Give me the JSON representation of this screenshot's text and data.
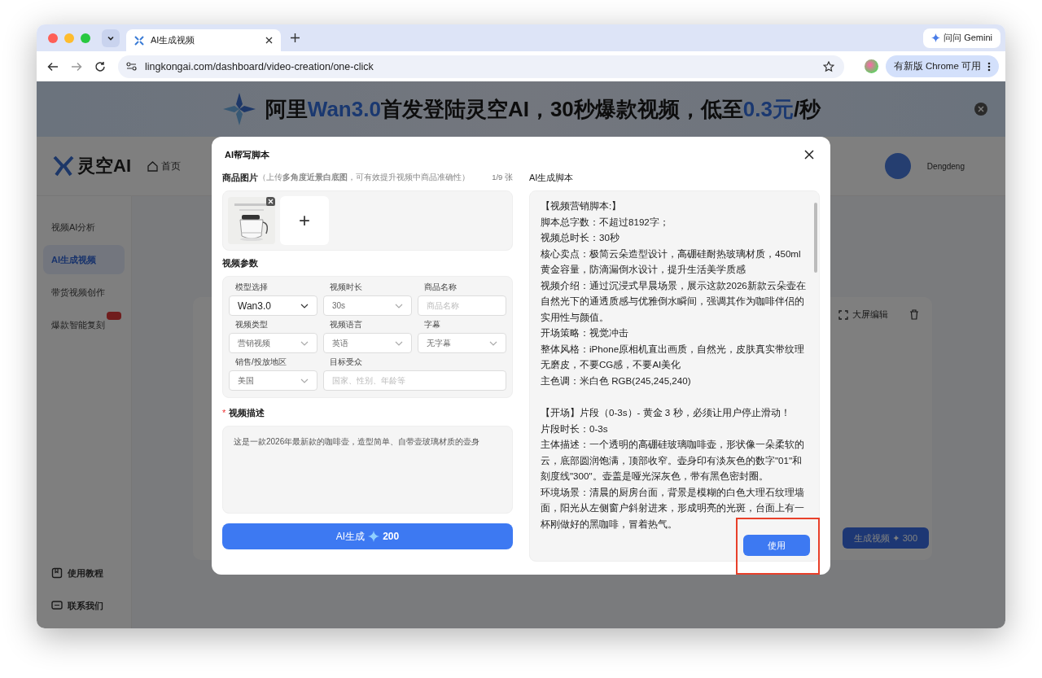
{
  "browser": {
    "tab_title": "AI生成视频",
    "url": "lingkongai.com/dashboard/video-creation/one-click",
    "gemini_button": "问问 Gemini",
    "update_button": "有新版 Chrome 可用"
  },
  "app": {
    "banner": {
      "segments": [
        {
          "text": "阿里",
          "highlight": false
        },
        {
          "text": "Wan3.0",
          "highlight": true
        },
        {
          "text": "首发登陆灵空AI，30秒爆款视频，低至",
          "highlight": false
        },
        {
          "text": "0.3元",
          "highlight": true
        },
        {
          "text": "/秒",
          "highlight": false
        }
      ]
    },
    "logo": "灵空AI",
    "nav_home": "首页",
    "user": {
      "name": "Dengdeng"
    },
    "sidebar": {
      "items": [
        {
          "label": "视频AI分析",
          "selected": false,
          "hot": false
        },
        {
          "label": "AI生成视频",
          "selected": true,
          "hot": false
        },
        {
          "label": "带货视频创作",
          "selected": false,
          "hot": false
        },
        {
          "label": "爆款智能复刻",
          "selected": false,
          "hot": true
        }
      ],
      "footer": [
        "使用教程",
        "联系我们"
      ]
    },
    "main": {
      "fullscreen_button": "大屏编辑",
      "generate_button": "生成视频",
      "generate_icon": "✦",
      "generate_cost": "300"
    }
  },
  "modal": {
    "title": "AI帮写脚本",
    "product_images": {
      "label": "商品图片",
      "hint": "（上传**多角度近景白底图**，可有效提升视频中商品准确性）",
      "count": "1/9 张",
      "add_label": "+"
    },
    "params": {
      "title": "视频参数",
      "fields": [
        {
          "label": "模型选择",
          "kind": "select",
          "value": "Wan3.0",
          "disabled": false,
          "wide": false
        },
        {
          "label": "视频时长",
          "kind": "select",
          "value": "30s",
          "disabled": true,
          "wide": false
        },
        {
          "label": "商品名称",
          "kind": "input",
          "placeholder": "商品名称",
          "wide": false
        },
        {
          "label": "视频类型",
          "kind": "select",
          "value": "营销视频",
          "disabled": true,
          "wide": false
        },
        {
          "label": "视频语言",
          "kind": "select",
          "value": "英语",
          "disabled": true,
          "wide": false
        },
        {
          "label": "字幕",
          "kind": "select",
          "value": "无字幕",
          "disabled": true,
          "wide": false
        },
        {
          "label": "销售/投放地区",
          "kind": "select",
          "value": "美国",
          "disabled": true,
          "wide": false
        },
        {
          "label": "目标受众",
          "kind": "input",
          "placeholder": "国家、性别、年龄等",
          "wide": true
        }
      ]
    },
    "description": {
      "label": "视频描述",
      "required_mark": "*",
      "value": "这是一款2026年最新款的咖啡壶，造型简单、自带壶玻璃材质的壶身"
    },
    "generate_button": {
      "label": "AI生成",
      "cost": "200"
    },
    "script": {
      "title": "AI生成脚本",
      "sections": [
        [
          "【视频营销脚本:】",
          "脚本总字数：不超过8192字；",
          "视频总时长：30秒",
          "核心卖点：极简云朵造型设计，高硼硅耐热玻璃材质，450ml 黄金容量，防滴漏倒水设计，提升生活美学质感",
          "视频介绍：通过沉浸式早晨场景，展示这款2026新款云朵壶在自然光下的通透质感与优雅倒水瞬间，强调其作为咖啡伴侣的实用性与颜值。",
          "开场策略：视觉冲击",
          "整体风格：iPhone原相机直出画质，自然光，皮肤真实带纹理无磨皮，不要CG感，不要AI美化",
          "主色调：米白色 RGB(245,245,240)"
        ],
        [
          "【开场】片段（0-3s）- 黄金 3 秒，必须让用户停止滑动！",
          "片段时长：0-3s",
          "主体描述：一个透明的高硼硅玻璃咖啡壶，形状像一朵柔软的云，底部圆润饱满，顶部收窄。壶身印有淡灰色的数字\"01\"和刻度线\"300\"。壶盖是哑光深灰色，带有黑色密封圈。",
          "环境场景：清晨的厨房台面，背景是模糊的白色大理石纹理墙面，阳光从左侧窗户斜射进来，形成明亮的光斑，台面上有一杯刚做好的黑咖啡，冒着热气。"
        ]
      ],
      "use_button": "使用"
    },
    "highlight_box": true
  }
}
